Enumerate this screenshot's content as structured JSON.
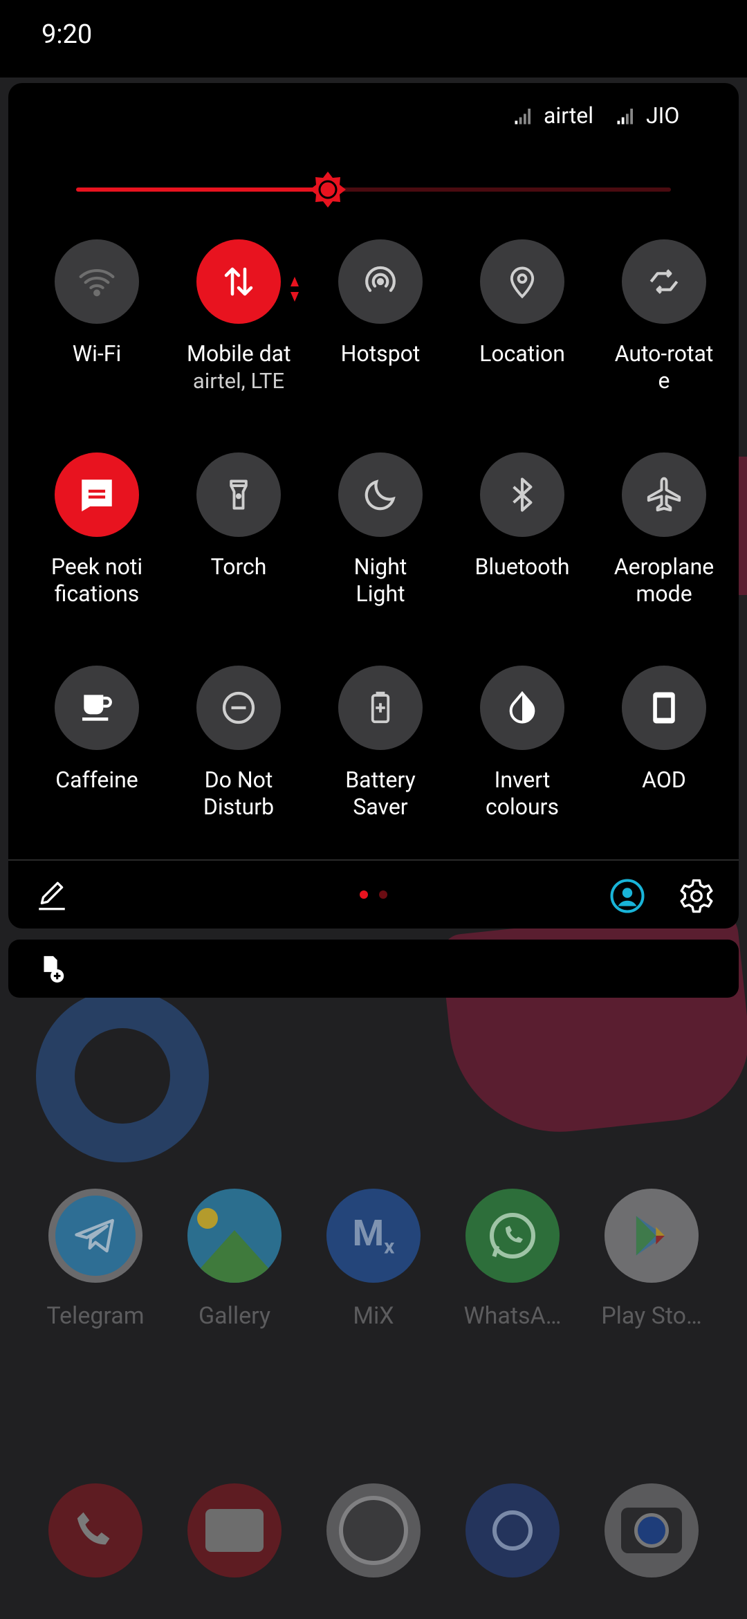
{
  "status_bar": {
    "time": "9:20"
  },
  "carriers": [
    {
      "name": "airtel",
      "icon": "signal-icon"
    },
    {
      "name": "JIO",
      "icon": "signal-icon"
    }
  ],
  "brightness": {
    "level": 0.42,
    "accent": "#e8131f"
  },
  "tiles": [
    {
      "id": "wifi",
      "label": "Wi-Fi",
      "on": false,
      "icon": "wifi-icon"
    },
    {
      "id": "mobile-data",
      "label": "Mobile dat",
      "sub": "airtel, LTE",
      "on": true,
      "icon": "data-arrows-icon"
    },
    {
      "id": "hotspot",
      "label": "Hotspot",
      "on": false,
      "icon": "hotspot-icon"
    },
    {
      "id": "location",
      "label": "Location",
      "on": false,
      "icon": "location-pin-icon"
    },
    {
      "id": "auto-rotate",
      "label": "Auto-rotat\ne",
      "on": false,
      "icon": "rotate-icon"
    },
    {
      "id": "peek",
      "label": "Peek noti\nfications",
      "on": true,
      "icon": "message-icon"
    },
    {
      "id": "torch",
      "label": "Torch",
      "on": false,
      "icon": "flashlight-icon"
    },
    {
      "id": "night-light",
      "label": "Night\nLight",
      "on": false,
      "icon": "moon-icon"
    },
    {
      "id": "bluetooth",
      "label": "Bluetooth",
      "on": false,
      "icon": "bluetooth-icon"
    },
    {
      "id": "aeroplane",
      "label": "Aeroplane\nmode",
      "on": false,
      "icon": "airplane-icon"
    },
    {
      "id": "caffeine",
      "label": "Caffeine",
      "on": false,
      "icon": "coffee-cup-icon"
    },
    {
      "id": "dnd",
      "label": "Do Not\nDisturb",
      "on": false,
      "icon": "do-not-disturb-icon"
    },
    {
      "id": "battery-saver",
      "label": "Battery\nSaver",
      "on": false,
      "icon": "battery-plus-icon"
    },
    {
      "id": "invert",
      "label": "Invert\ncolours",
      "on": false,
      "icon": "invert-drop-icon"
    },
    {
      "id": "aod",
      "label": "AOD",
      "on": false,
      "icon": "phone-screen-icon"
    }
  ],
  "footer": {
    "pages": 2,
    "current_page": 1,
    "user_color": "#19b4d8"
  },
  "apps": [
    {
      "label": "Telegram",
      "icon": "telegram-icon"
    },
    {
      "label": "Gallery",
      "icon": "gallery-icon"
    },
    {
      "label": "MiX",
      "icon": "mix-icon"
    },
    {
      "label": "WhatsA…",
      "icon": "whatsapp-icon"
    },
    {
      "label": "Play Sto…",
      "icon": "play-store-icon"
    }
  ],
  "dock": [
    {
      "icon": "phone-icon"
    },
    {
      "icon": "messages-icon"
    },
    {
      "icon": "camera-app-icon"
    },
    {
      "icon": "chrome-icon"
    },
    {
      "icon": "camera-icon"
    }
  ]
}
